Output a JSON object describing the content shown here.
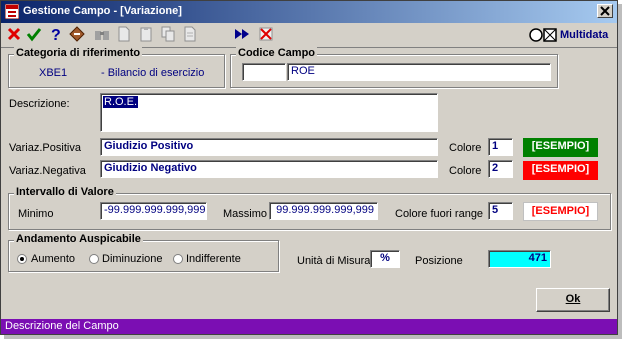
{
  "window": {
    "title": "Gestione Campo - [Variazione]"
  },
  "toolbar": {
    "brand": "Multidata"
  },
  "categoria": {
    "group_title": "Categoria di riferimento",
    "code": "XBE1",
    "desc": "- Bilancio di esercizio"
  },
  "codice_campo": {
    "group_title": "Codice Campo",
    "prefix": "",
    "value": "ROE"
  },
  "descrizione": {
    "label": "Descrizione:",
    "value": "R.O.E."
  },
  "variaz_positiva": {
    "label": "Variaz.Positiva",
    "value": "Giudizio Positivo",
    "colore_label": "Colore",
    "colore": "1",
    "example": "[ESEMPIO]",
    "bg": "#008000",
    "fg": "#ffffff"
  },
  "variaz_negativa": {
    "label": "Variaz.Negativa",
    "value": "Giudizio Negativo",
    "colore_label": "Colore",
    "colore": "2",
    "example": "[ESEMPIO]",
    "bg": "#ff0000",
    "fg": "#ffffff"
  },
  "intervallo": {
    "group_title": "Intervallo di Valore",
    "minimo_label": "Minimo",
    "minimo": "-99.999.999.999,999",
    "massimo_label": "Massimo",
    "massimo": "99.999.999.999,999",
    "fuori_label": "Colore fuori range",
    "fuori": "5",
    "example": "[ESEMPIO]",
    "bg": "#ffffff",
    "fg": "#ff0000"
  },
  "andamento": {
    "group_title": "Andamento Auspicabile",
    "options": [
      "Aumento",
      "Diminuzione",
      "Indifferente"
    ],
    "selected": "Aumento"
  },
  "unita": {
    "label": "Unità di Misura",
    "value": "%"
  },
  "posizione": {
    "label": "Posizione",
    "value": "471",
    "bg": "#00ffff"
  },
  "ok_button": "Ok",
  "status": "Descrizione del Campo"
}
